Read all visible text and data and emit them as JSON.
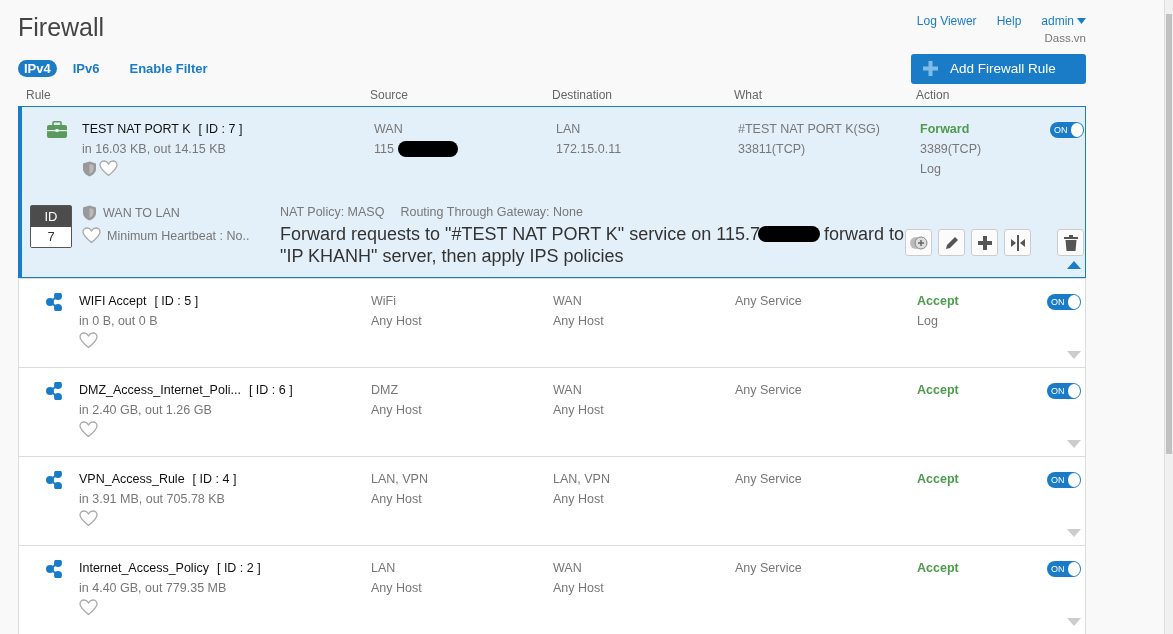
{
  "title": "Firewall",
  "top_links": [
    {
      "label": "Log Viewer"
    },
    {
      "label": "Help"
    }
  ],
  "user": {
    "name": "admin",
    "org": "Dass.vn"
  },
  "tabs": [
    {
      "label": "IPv4",
      "selected": true
    },
    {
      "label": "IPv6",
      "selected": false
    }
  ],
  "filter_link": "Enable Filter",
  "add_button": "Add Firewall Rule",
  "columns": [
    "Rule",
    "Source",
    "Destination",
    "What",
    "Action"
  ],
  "rules": [
    {
      "kind": "business",
      "name": "TEST NAT PORT K",
      "id_label": "[ ID : 7 ]",
      "traffic": "in 16.03 KB, out 14.15 KB",
      "ips": true,
      "source": [
        "WAN",
        "115"
      ],
      "source_redacted": true,
      "destination": [
        "LAN",
        "172.15.0.11"
      ],
      "what": [
        "#TEST NAT PORT K(SG)",
        "33811(TCP)"
      ],
      "action": "Forward",
      "action_lines": [
        "3389(TCP)",
        "Log"
      ],
      "on": true,
      "toggle_label": "ON",
      "expanded": true,
      "detail": {
        "id_title": "ID",
        "id_value": "7",
        "zone": "WAN TO LAN",
        "heartbeat": "Minimum Heartbeat : No..",
        "nat_policy": "NAT Policy: MASQ",
        "routing": "Routing Through Gateway: None",
        "description_before": "Forward requests to \"#TEST NAT PORT K\" service on 115.7",
        "description_middle": "forward to",
        "description_after": "\"IP KHANH\" server, then apply IPS policies"
      }
    },
    {
      "kind": "network",
      "name": "WIFI Accept",
      "id_label": "[ ID : 5 ]",
      "traffic": "in 0 B, out 0 B",
      "ips": false,
      "source": [
        "WiFi",
        "Any Host"
      ],
      "source_redacted": false,
      "destination": [
        "WAN",
        "Any Host"
      ],
      "what": [
        "Any Service"
      ],
      "action": "Accept",
      "action_lines": [
        "Log"
      ],
      "on": true,
      "toggle_label": "ON",
      "expanded": false
    },
    {
      "kind": "network",
      "name": "DMZ_Access_Internet_Poli...",
      "id_label": "[ ID : 6 ]",
      "traffic": "in 2.40 GB, out 1.26 GB",
      "ips": false,
      "source": [
        "DMZ",
        "Any Host"
      ],
      "source_redacted": false,
      "destination": [
        "WAN",
        "Any Host"
      ],
      "what": [
        "Any Service"
      ],
      "action": "Accept",
      "on": true,
      "toggle_label": "ON",
      "expanded": false
    },
    {
      "kind": "network",
      "name": "VPN_Access_Rule",
      "id_label": "[ ID : 4 ]",
      "traffic": "in 3.91 MB, out 705.78 KB",
      "ips": false,
      "source": [
        "LAN, VPN",
        "Any Host"
      ],
      "source_redacted": false,
      "destination": [
        "LAN, VPN",
        "Any Host"
      ],
      "what": [
        "Any Service"
      ],
      "action": "Accept",
      "on": true,
      "toggle_label": "ON",
      "expanded": false
    },
    {
      "kind": "network",
      "name": "Internet_Access_Policy",
      "id_label": "[ ID : 2 ]",
      "traffic": "in 4.40 GB, out 779.35 MB",
      "ips": false,
      "source": [
        "LAN",
        "Any Host"
      ],
      "source_redacted": false,
      "destination": [
        "WAN",
        "Any Host"
      ],
      "what": [
        "Any Service"
      ],
      "action": "Accept",
      "on": true,
      "toggle_label": "ON",
      "expanded": false
    }
  ]
}
